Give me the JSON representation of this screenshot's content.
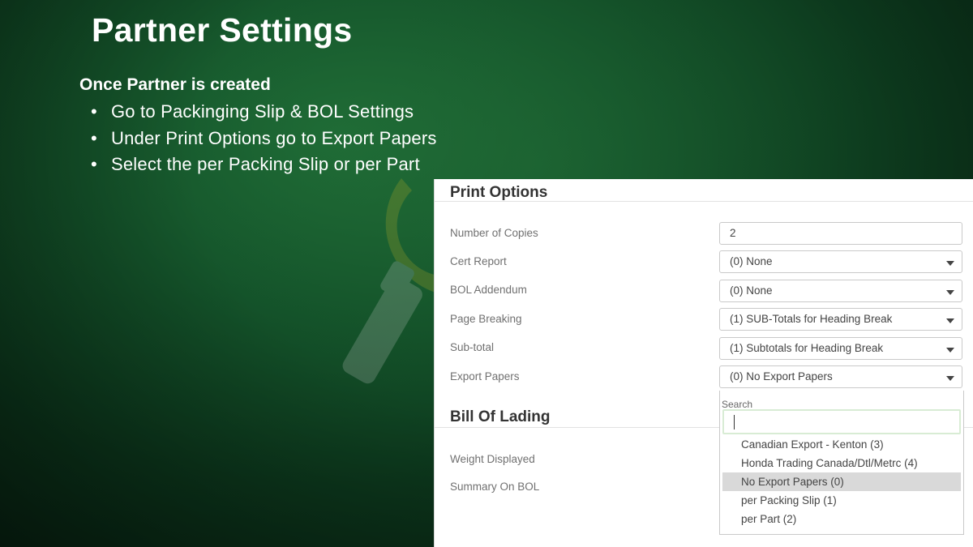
{
  "slide": {
    "title": "Partner Settings",
    "subtitle": "Once Partner is created",
    "bullets": [
      "Go to Packinging Slip & BOL Settings",
      "Under Print Options go to Export Papers",
      "Select the per Packing Slip or per Part"
    ]
  },
  "print_options": {
    "title": "Print Options",
    "fields": [
      {
        "label": "Number of Copies",
        "value": "2",
        "type": "text"
      },
      {
        "label": "Cert Report",
        "value": "(0) None",
        "type": "select"
      },
      {
        "label": "BOL Addendum",
        "value": "(0) None",
        "type": "select"
      },
      {
        "label": "Page Breaking",
        "value": "(1) SUB-Totals for Heading Break",
        "type": "select"
      },
      {
        "label": "Sub-total",
        "value": "(1) Subtotals for Heading Break",
        "type": "select"
      },
      {
        "label": "Export Papers",
        "value": "(0) No Export Papers",
        "type": "select"
      }
    ]
  },
  "export_dropdown": {
    "search_label": "Search",
    "search_value": "",
    "options": [
      "Canadian Export - Kenton (3)",
      "Honda Trading Canada/Dtl/Metrc (4)",
      "No Export Papers (0)",
      "per Packing Slip (1)",
      "per Part (2)"
    ],
    "selected": "No Export Papers (0)"
  },
  "bill_of_lading": {
    "title": "Bill Of Lading",
    "fields": [
      {
        "label": "Weight Displayed"
      },
      {
        "label": "Summary On BOL"
      }
    ]
  },
  "colors": {
    "background": "#0d3b1e",
    "text_light": "#ffffff",
    "selected_option": "#d9d9d9",
    "search_focus": "#d8ecd4"
  },
  "icons": [
    "chevron-down-icon",
    "text-cursor-icon",
    "partner-logo-watermark"
  ]
}
